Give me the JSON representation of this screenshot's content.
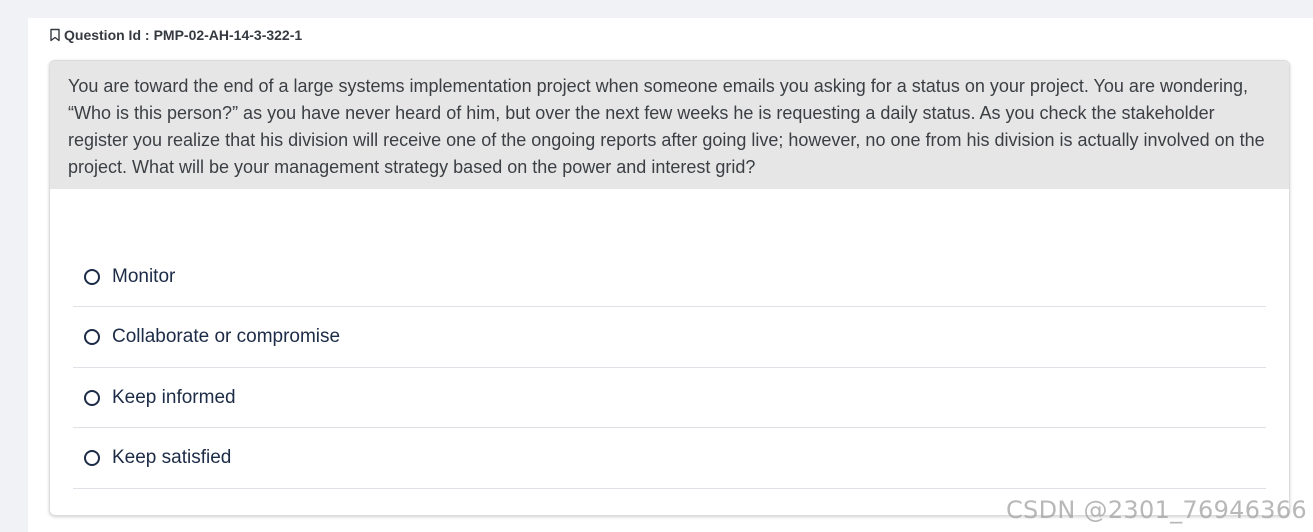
{
  "question": {
    "id_label": "Question Id :",
    "id_value": "PMP-02-AH-14-3-322-1",
    "text": "You are toward the end of a large systems implementation project when someone emails you asking for a status on your project. You are wondering, “Who is this person?” as you have never heard of him, but over the next few weeks he is requesting a daily status. As you check the stakeholder register you realize that his division will receive one of the ongoing reports after going live; however, no one from his division is actually involved on the project. What will be your management strategy based on the power and interest grid?"
  },
  "options": [
    {
      "label": "Monitor"
    },
    {
      "label": "Collaborate or compromise"
    },
    {
      "label": "Keep informed"
    },
    {
      "label": "Keep satisfied"
    }
  ],
  "watermark": "CSDN @2301_76946366",
  "icons": {
    "bookmark": "bookmark-icon",
    "radio": "radio-icon"
  }
}
